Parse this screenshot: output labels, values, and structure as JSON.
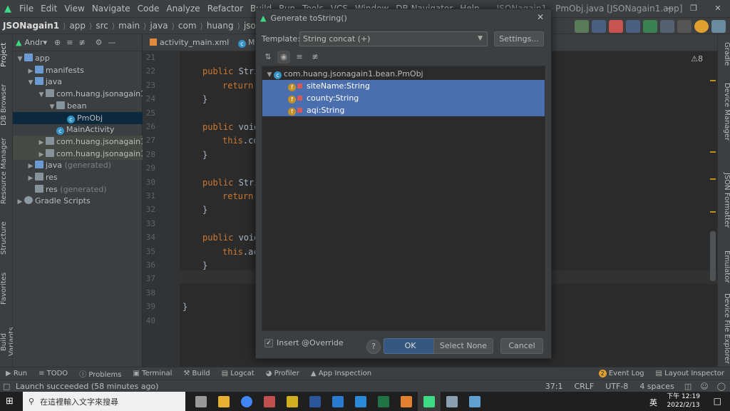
{
  "menubar": {
    "items": [
      "File",
      "Edit",
      "View",
      "Navigate",
      "Code",
      "Analyze",
      "Refactor",
      "Build",
      "Run",
      "Tools",
      "VCS",
      "Window",
      "DB Navigator",
      "Help"
    ],
    "title": "JSONagain1 - PmObj.java [JSONagain1.app]",
    "window_controls": [
      "—",
      "❐",
      "✕"
    ]
  },
  "navbar": {
    "crumbs": [
      "JSONagain1",
      "app",
      "src",
      "main",
      "java",
      "com",
      "huang",
      "jsonagain1"
    ]
  },
  "left_strip": [
    "Project",
    "DB Browser",
    "Resource Manager",
    "Structure",
    "Favorites",
    "Build Variants"
  ],
  "right_strip": [
    "Gradle",
    "Device Manager",
    "JSON Formatter",
    "Emulator",
    "Device File Explorer"
  ],
  "project": {
    "header": "Andr▾",
    "tree": [
      {
        "label": "app",
        "depth": 0,
        "arrow": "▼",
        "icon": "folder-blue"
      },
      {
        "label": "manifests",
        "depth": 1,
        "arrow": "▶",
        "icon": "folder-blue"
      },
      {
        "label": "java",
        "depth": 1,
        "arrow": "▼",
        "icon": "folder-blue"
      },
      {
        "label": "com.huang.jsonagain1",
        "depth": 2,
        "arrow": "▼",
        "icon": "folder"
      },
      {
        "label": "bean",
        "depth": 3,
        "arrow": "▼",
        "icon": "folder"
      },
      {
        "label": "PmObj",
        "depth": 4,
        "arrow": "",
        "icon": "class"
      },
      {
        "label": "MainActivity",
        "depth": 3,
        "arrow": "",
        "icon": "class"
      },
      {
        "label": "com.huang.jsonagain1",
        "depth": 2,
        "arrow": "▶",
        "icon": "folder"
      },
      {
        "label": "com.huang.jsonagain1",
        "depth": 2,
        "arrow": "▶",
        "icon": "folder"
      },
      {
        "label": "java",
        "suffix": " (generated)",
        "depth": 1,
        "arrow": "▶",
        "icon": "folder-blue"
      },
      {
        "label": "res",
        "depth": 1,
        "arrow": "▶",
        "icon": "folder"
      },
      {
        "label": "res",
        "suffix": " (generated)",
        "depth": 1,
        "arrow": "",
        "icon": "folder"
      },
      {
        "label": "Gradle Scripts",
        "depth": 0,
        "arrow": "▶",
        "icon": "gradle"
      }
    ]
  },
  "editor": {
    "tabs": [
      "activity_main.xml",
      "M"
    ],
    "line_numbers": [
      "21",
      "22",
      "23",
      "24",
      "25",
      "26",
      "27",
      "28",
      "29",
      "30",
      "31",
      "32",
      "33",
      "34",
      "35",
      "36",
      "37",
      "38",
      "39",
      "40"
    ],
    "lines": [
      {
        "kw": "",
        "text": ""
      },
      {
        "kw": "public ",
        "text": "Stri"
      },
      {
        "kw": "return",
        "text": ""
      },
      {
        "kw": "",
        "text": "}"
      },
      {
        "kw": "",
        "text": ""
      },
      {
        "kw": "public ",
        "text": "void"
      },
      {
        "kw": "this",
        "text": ".co"
      },
      {
        "kw": "",
        "text": "}"
      },
      {
        "kw": "",
        "text": ""
      },
      {
        "kw": "public ",
        "text": "Stri"
      },
      {
        "kw": "return",
        "text": ""
      },
      {
        "kw": "",
        "text": "}"
      },
      {
        "kw": "",
        "text": ""
      },
      {
        "kw": "public ",
        "text": "void"
      },
      {
        "kw": "this",
        "text": ".ac"
      },
      {
        "kw": "",
        "text": "}"
      },
      {
        "kw": "",
        "text": ""
      },
      {
        "kw": "",
        "text": ""
      },
      {
        "kw": "",
        "text": "}"
      },
      {
        "kw": "",
        "text": ""
      }
    ],
    "warnings": "⚠8"
  },
  "dialog": {
    "title": "Generate toString()",
    "template_label": "Template:",
    "template_value": "String concat (+)",
    "settings": "Settings...",
    "class_node": "com.huang.jsonagain1.bean.PmObj",
    "fields": [
      "siteName:String",
      "county:String",
      "aqi:String"
    ],
    "override_label": "Insert @Override",
    "override_checked": true,
    "help": "?",
    "ok": "OK",
    "select_none": "Select None",
    "cancel": "Cancel"
  },
  "toolwindows": {
    "left": [
      "Run",
      "TODO",
      "Problems",
      "Terminal",
      "Build",
      "Logcat",
      "Profiler",
      "App Inspection"
    ],
    "right": [
      "Event Log",
      "Layout Inspector"
    ],
    "event_badge": "2"
  },
  "status": {
    "message": "Launch succeeded (58 minutes ago)",
    "position": "37:1",
    "line_sep": "CRLF",
    "encoding": "UTF-8",
    "indent": "4 spaces"
  },
  "taskbar": {
    "search_placeholder": "在這裡輸入文字來搜尋",
    "ime": "英",
    "time": "下午 12:19",
    "date": "2022/2/13"
  }
}
